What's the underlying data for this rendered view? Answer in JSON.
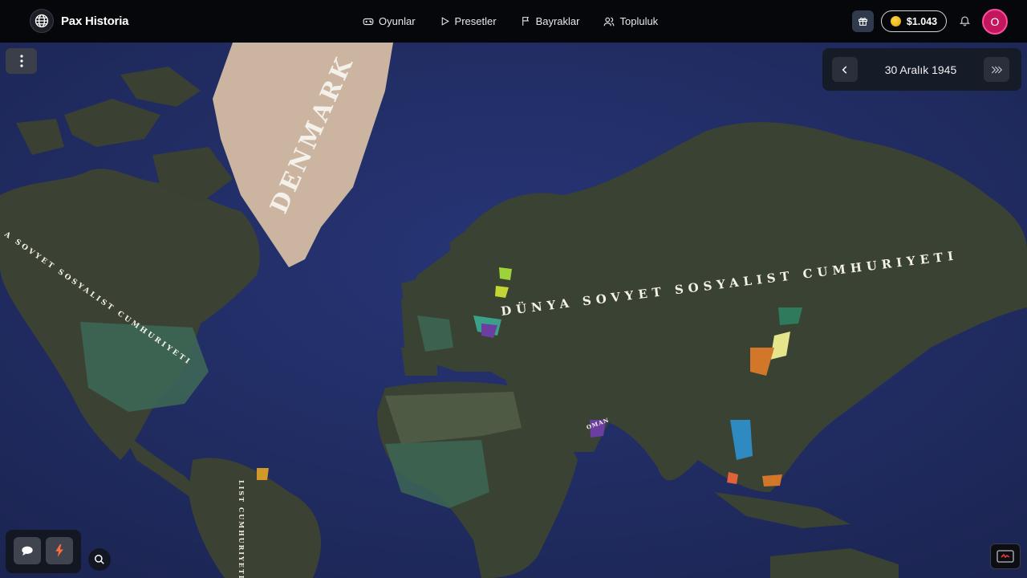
{
  "app": {
    "name": "Pax Historia"
  },
  "nav": {
    "games": "Oyunlar",
    "presets": "Presetler",
    "flags": "Bayraklar",
    "community": "Topluluk"
  },
  "user": {
    "balance": "$1.043",
    "avatar_initial": "O"
  },
  "timeline": {
    "date": "30 Aralık 1945"
  },
  "map": {
    "labels": {
      "denmark": "DENMARK",
      "soviet_main": "DÜNYA SOVYET SOSYALIST CUMHURIYETI",
      "soviet_west": "A SOVYET SOSYALIST CUMHURIYETI",
      "soviet_south": "LIST CUMHURIYETI",
      "oman": "OMAN"
    },
    "colors": {
      "ocean": "#1e2a5c",
      "land": "#3a4234",
      "ice": "#cbb5a0",
      "accent": "#e91e63"
    }
  },
  "icons": [
    "globe-icon",
    "gamepad-icon",
    "play-icon",
    "flag-icon",
    "users-icon",
    "gift-icon",
    "coin-icon",
    "bell-icon",
    "more-vertical-icon",
    "chevron-left-icon",
    "chevrons-right-icon",
    "chat-icon",
    "bolt-icon",
    "search-icon",
    "record-icon"
  ]
}
